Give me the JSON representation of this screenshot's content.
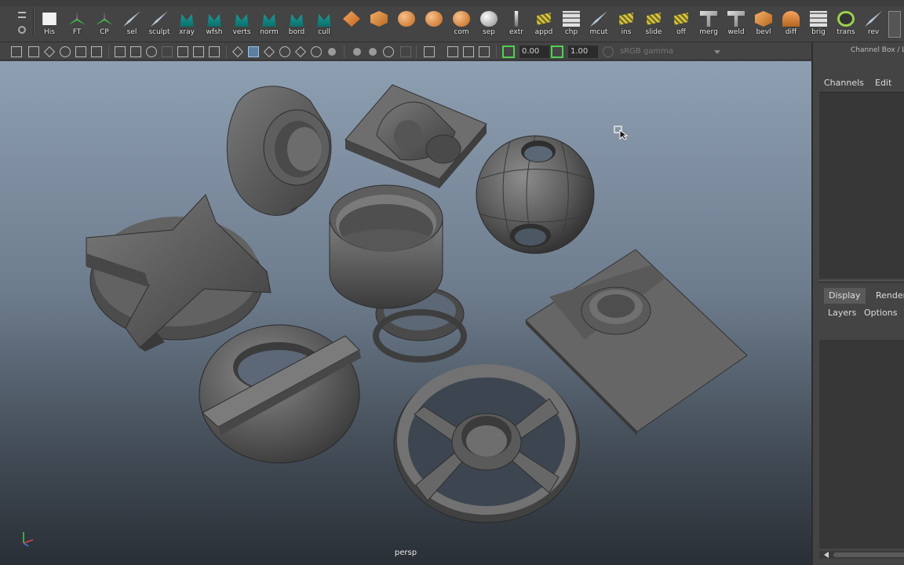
{
  "shelf": {
    "buttons": [
      {
        "label": "His",
        "icon": "history-icon"
      },
      {
        "label": "FT",
        "icon": "freeze-transform-icon"
      },
      {
        "label": "CP",
        "icon": "center-pivot-icon"
      },
      {
        "label": "sel",
        "icon": "select-brush-icon"
      },
      {
        "label": "sculpt",
        "icon": "sculpt-brush-icon"
      },
      {
        "label": "xray",
        "icon": "xray-icon"
      },
      {
        "label": "wfsh",
        "icon": "wireframe-shaded-icon"
      },
      {
        "label": "verts",
        "icon": "vertices-icon"
      },
      {
        "label": "norm",
        "icon": "normals-icon"
      },
      {
        "label": "bord",
        "icon": "border-edges-icon"
      },
      {
        "label": "cull",
        "icon": "backface-cull-icon"
      },
      {
        "label": "",
        "icon": "poly-plane-icon"
      },
      {
        "label": "",
        "icon": "poly-cube-icon"
      },
      {
        "label": "",
        "icon": "poly-sphere-icon"
      },
      {
        "label": "",
        "icon": "poly-cylinder-icon"
      },
      {
        "label": "com",
        "icon": "combine-icon"
      },
      {
        "label": "sep",
        "icon": "separate-icon"
      },
      {
        "label": "extr",
        "icon": "extrude-icon"
      },
      {
        "label": "appd",
        "icon": "append-icon"
      },
      {
        "label": "chp",
        "icon": "chamfer-icon"
      },
      {
        "label": "mcut",
        "icon": "multi-cut-icon"
      },
      {
        "label": "ins",
        "icon": "insert-loop-icon"
      },
      {
        "label": "slide",
        "icon": "slide-edge-icon"
      },
      {
        "label": "off",
        "icon": "offset-loop-icon"
      },
      {
        "label": "merg",
        "icon": "merge-icon"
      },
      {
        "label": "weld",
        "icon": "weld-icon"
      },
      {
        "label": "bevl",
        "icon": "bevel-icon"
      },
      {
        "label": "diff",
        "icon": "difference-icon"
      },
      {
        "label": "brig",
        "icon": "bridge-icon"
      },
      {
        "label": "trans",
        "icon": "transfer-icon"
      },
      {
        "label": "rev",
        "icon": "reverse-icon"
      }
    ]
  },
  "viewbar": {
    "exposure": "0.00",
    "gamma": "1.00",
    "color_space": "sRGB gamma"
  },
  "viewport": {
    "camera_label": "persp"
  },
  "panel": {
    "title": "Channel Box / Lay",
    "menu_channels": "Channels",
    "menu_edit": "Edit",
    "tab_display": "Display",
    "tab_render": "Render",
    "sub_layers": "Layers",
    "sub_options": "Options"
  },
  "colors": {
    "shelf_bg": "#444444",
    "viewport_top": "#8e9fb2",
    "viewport_bottom": "#2a2f36",
    "model_gray": "#6a6a6a",
    "accent_green": "#4fd14f"
  }
}
